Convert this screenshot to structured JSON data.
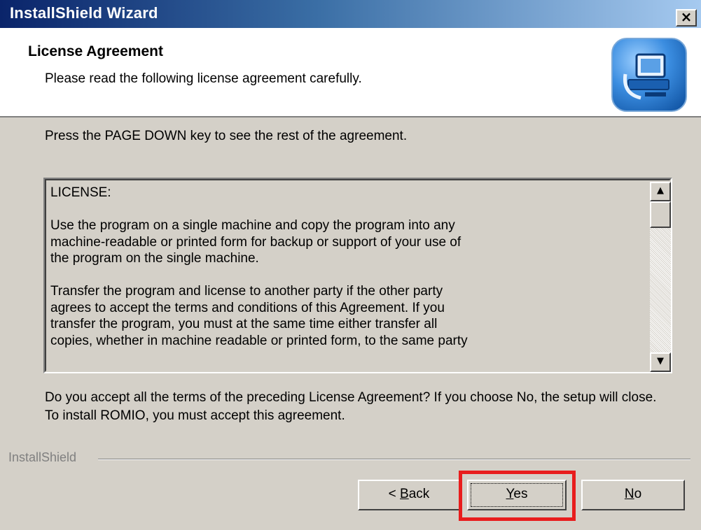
{
  "window": {
    "title": "InstallShield Wizard",
    "close_label": "×"
  },
  "header": {
    "title": "License Agreement",
    "subtitle": "Please read the following license agreement carefully.",
    "logo_icon": "computer-setup-icon"
  },
  "instruction": "Press the PAGE DOWN key to see the rest of the agreement.",
  "license": {
    "heading": "LICENSE:",
    "paragraph1": "Use the program on a single machine and copy the program into any\nmachine-readable or printed form for backup or support of your use of\nthe program on the single machine.",
    "paragraph2": "Transfer the program and license to another party if the other party\nagrees to accept the terms and conditions of this Agreement.  If you\ntransfer the program, you must at the same time either transfer all\ncopies, whether in machine readable or printed form, to the same party"
  },
  "scrollbar": {
    "up_glyph": "▲",
    "down_glyph": "▼",
    "position": 0.0
  },
  "question": "Do you accept all the terms of the preceding License Agreement?  If you choose No,  the setup will close.  To install ROMIO, you must accept this agreement.",
  "footer": {
    "brand": "InstallShield"
  },
  "buttons": {
    "back_prefix": "< ",
    "back_mnemonic": "B",
    "back_rest": "ack",
    "yes_mnemonic": "Y",
    "yes_rest": "es",
    "no_mnemonic": "N",
    "no_rest": "o"
  },
  "colors": {
    "highlight": "#e81d1d",
    "titlebar_start": "#0a246a",
    "titlebar_end": "#a6caf0",
    "dialog_bg": "#d4d0c8"
  }
}
